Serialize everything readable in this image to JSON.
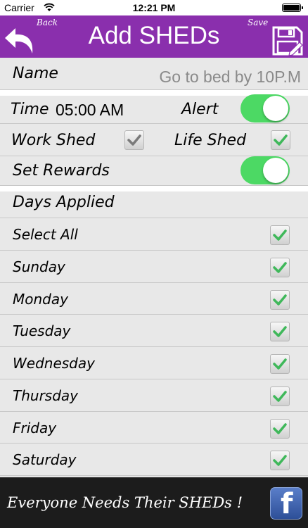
{
  "status_bar": {
    "carrier": "Carrier",
    "time": "12:21 PM",
    "wifi_icon": "wifi-icon",
    "battery_icon": "battery-icon"
  },
  "nav": {
    "title": "Add SHEDs",
    "back_label": "Back",
    "save_label": "Save",
    "back_icon": "back-arrow-icon",
    "save_icon": "floppy-disk-icon",
    "bar_color": "#8a2fad"
  },
  "form": {
    "name_label": "Name",
    "name_value": "Go to bed by 10P.M",
    "time_label": "Time",
    "time_value": "05:00 AM",
    "alert_label": "Alert",
    "alert_on": true,
    "work_shed_label": "Work Shed",
    "work_shed_checked": true,
    "life_shed_label": "Life Shed",
    "life_shed_checked": true,
    "rewards_label": "Set Rewards",
    "rewards_on": true,
    "days_label": "Days Applied",
    "toggle_color": "#4cd964"
  },
  "days": [
    {
      "label": "Select All",
      "checked": true
    },
    {
      "label": "Sunday",
      "checked": true
    },
    {
      "label": "Monday",
      "checked": true
    },
    {
      "label": "Tuesday",
      "checked": true
    },
    {
      "label": "Wednesday",
      "checked": true
    },
    {
      "label": "Thursday",
      "checked": true
    },
    {
      "label": "Friday",
      "checked": true
    },
    {
      "label": "Saturday",
      "checked": true
    }
  ],
  "footer": {
    "slogan": "Everyone Needs Their SHEDs !",
    "facebook_glyph": "f",
    "facebook_icon": "facebook-icon"
  }
}
